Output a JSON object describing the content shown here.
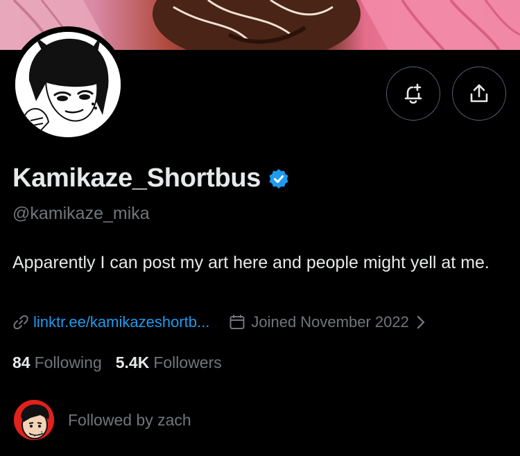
{
  "profile": {
    "display_name": "Kamikaze_Shortbus",
    "handle": "@kamikaze_mika",
    "bio": "Apparently I can post my art here and people might yell at me.",
    "verified": true,
    "link": "linktr.ee/kamikazeshortb...",
    "joined": "Joined November 2022"
  },
  "stats": {
    "following_count": "84",
    "following_label": "Following",
    "followers_count": "5.4K",
    "followers_label": "Followers"
  },
  "followed_by": {
    "text": "Followed by zach"
  },
  "icons": {
    "notify": "bell-plus-icon",
    "share": "share-upload-icon",
    "link": "link-icon",
    "calendar": "calendar-icon",
    "chevron": "chevron-right-icon",
    "verified": "verified-badge-icon"
  },
  "colors": {
    "background": "#000000",
    "text_primary": "#e7e9ea",
    "text_secondary": "#71767b",
    "link": "#1d9bf0",
    "verified": "#1d9bf0",
    "button_border": "#536471"
  }
}
